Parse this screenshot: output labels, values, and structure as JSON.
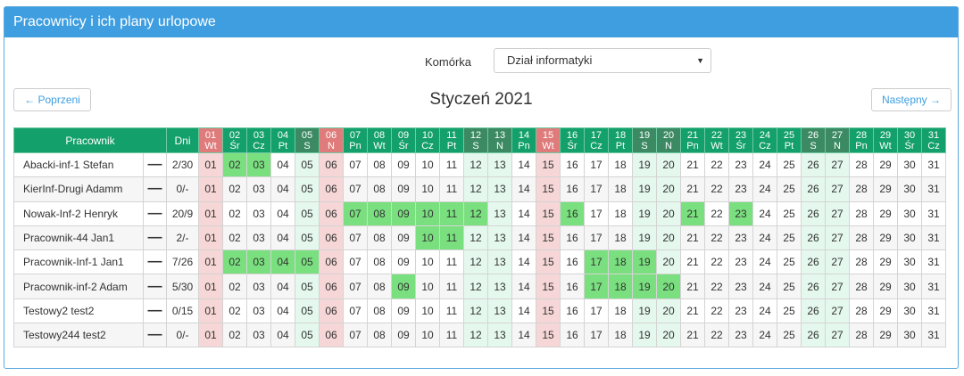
{
  "panel": {
    "title": "Pracownicy i ich plany urlopowe"
  },
  "filter": {
    "label": "Komórka",
    "selected": "Dział informatyki"
  },
  "nav": {
    "prev": "← Poprzeni",
    "next": "Następny →",
    "month": "Styczeń 2021"
  },
  "table": {
    "col_employee": "Pracownik",
    "col_days": "Dni",
    "remove_glyph": "—",
    "days": [
      {
        "d": "01",
        "w": "Wt",
        "t": "holiday"
      },
      {
        "d": "02",
        "w": "Śr",
        "t": ""
      },
      {
        "d": "03",
        "w": "Cz",
        "t": ""
      },
      {
        "d": "04",
        "w": "Pt",
        "t": ""
      },
      {
        "d": "05",
        "w": "S",
        "t": "weekend"
      },
      {
        "d": "06",
        "w": "N",
        "t": "holiday"
      },
      {
        "d": "07",
        "w": "Pn",
        "t": ""
      },
      {
        "d": "08",
        "w": "Wt",
        "t": ""
      },
      {
        "d": "09",
        "w": "Śr",
        "t": ""
      },
      {
        "d": "10",
        "w": "Cz",
        "t": ""
      },
      {
        "d": "11",
        "w": "Pt",
        "t": ""
      },
      {
        "d": "12",
        "w": "S",
        "t": "weekend"
      },
      {
        "d": "13",
        "w": "N",
        "t": "weekend"
      },
      {
        "d": "14",
        "w": "Pn",
        "t": ""
      },
      {
        "d": "15",
        "w": "Wt",
        "t": "holiday"
      },
      {
        "d": "16",
        "w": "Śr",
        "t": ""
      },
      {
        "d": "17",
        "w": "Cz",
        "t": ""
      },
      {
        "d": "18",
        "w": "Pt",
        "t": ""
      },
      {
        "d": "19",
        "w": "S",
        "t": "weekend"
      },
      {
        "d": "20",
        "w": "N",
        "t": "weekend"
      },
      {
        "d": "21",
        "w": "Pn",
        "t": ""
      },
      {
        "d": "22",
        "w": "Wt",
        "t": ""
      },
      {
        "d": "23",
        "w": "Śr",
        "t": ""
      },
      {
        "d": "24",
        "w": "Cz",
        "t": ""
      },
      {
        "d": "25",
        "w": "Pt",
        "t": ""
      },
      {
        "d": "26",
        "w": "S",
        "t": "weekend"
      },
      {
        "d": "27",
        "w": "N",
        "t": "weekend"
      },
      {
        "d": "28",
        "w": "Pn",
        "t": ""
      },
      {
        "d": "29",
        "w": "Wt",
        "t": ""
      },
      {
        "d": "30",
        "w": "Śr",
        "t": ""
      },
      {
        "d": "31",
        "w": "Cz",
        "t": ""
      }
    ],
    "rows": [
      {
        "name": "Abacki-inf-1 Stefan",
        "dni": "2/30",
        "vacation": [
          "02",
          "03"
        ]
      },
      {
        "name": "KierInf-Drugi Adamm",
        "dni": "0/-",
        "vacation": []
      },
      {
        "name": "Nowak-Inf-2 Henryk",
        "dni": "20/9",
        "vacation": [
          "07",
          "08",
          "09",
          "10",
          "11",
          "12",
          "16",
          "21",
          "23"
        ]
      },
      {
        "name": "Pracownik-44 Jan1",
        "dni": "2/-",
        "vacation": [
          "10",
          "11"
        ]
      },
      {
        "name": "Pracownik-Inf-1 Jan1",
        "dni": "7/26",
        "vacation": [
          "02",
          "03",
          "04",
          "05",
          "17",
          "18",
          "19"
        ]
      },
      {
        "name": "Pracownik-inf-2 Adam",
        "dni": "5/30",
        "vacation": [
          "09",
          "17",
          "18",
          "19",
          "20"
        ]
      },
      {
        "name": "Testowy2 test2",
        "dni": "0/15",
        "vacation": []
      },
      {
        "name": "Testowy244 test2",
        "dni": "0/-",
        "vacation": []
      }
    ]
  },
  "colors": {
    "header": "#3e9ee0",
    "table_header": "#14a06a",
    "weekend_header": "#3c8a64",
    "holiday": "#e07b7b",
    "vacation": "#7ae07f",
    "remove": "#e8532e"
  }
}
